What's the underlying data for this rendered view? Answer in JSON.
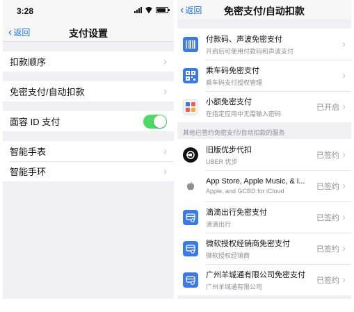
{
  "left": {
    "status_bar": {
      "time": "3:28"
    },
    "nav": {
      "back_label": "返回",
      "title": "支付设置"
    },
    "items": [
      {
        "label": "扣款顺序"
      },
      {
        "label": "免密支付/自动扣款"
      },
      {
        "label": "面容 ID 支付",
        "toggle_on": true
      },
      {
        "label": "智能手表"
      },
      {
        "label": "智能手环"
      }
    ]
  },
  "right": {
    "nav": {
      "back_label": "返回",
      "title": "免密支付/自动扣款"
    },
    "top_items": [
      {
        "title": "付款码、声波免密支付",
        "subtitle": "开启后可使用付款码和声波支付",
        "icon": "barcode-icon"
      },
      {
        "title": "乘车码免密支付",
        "subtitle": "乘车码支付授权管理",
        "icon": "qr-ticket-icon"
      },
      {
        "title": "小额免密支付",
        "subtitle": "在指定应用中无需输入密码",
        "status": "已开启",
        "icon": "small-payment-icon"
      }
    ],
    "section_header": "其他已签约免密支付/自动扣款的服务",
    "services": [
      {
        "title": "旧版优步代扣",
        "subtitle": "UBER 优步",
        "status": "已签约",
        "icon": "uber-icon"
      },
      {
        "title": "App Store, Apple Music, & i...",
        "subtitle": "Apple, and GCBD for iCloud",
        "status": "已签约",
        "icon": "apple-icon"
      },
      {
        "title": "滴滴出行免密支付",
        "subtitle": "滴滴出行",
        "status": "已签约",
        "icon": "service-icon"
      },
      {
        "title": "微软授权经销商免密支付",
        "subtitle": "微软授权经销商",
        "status": "已签约",
        "icon": "service-icon"
      },
      {
        "title": "广州羊城通有限公司免密支付",
        "subtitle": "广州羊城通有限公司",
        "status": "已签约",
        "icon": "service-icon"
      }
    ]
  },
  "colors": {
    "accent_blue": "#1a73e8",
    "icon_blue": "#3d7ae0",
    "toggle_green": "#4cd964",
    "background_gray": "#efeff4",
    "secondary_text": "#8e8e93"
  }
}
